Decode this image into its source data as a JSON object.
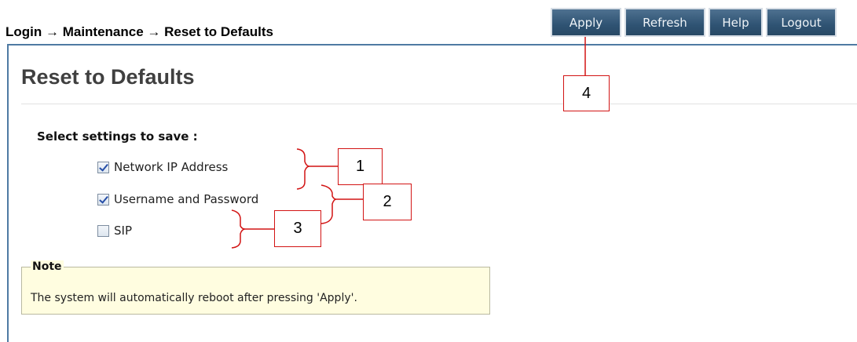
{
  "breadcrumb": "Login → Maintenance → Reset to Defaults",
  "toolbar": {
    "apply_label": "Apply",
    "refresh_label": "Refresh",
    "help_label": "Help",
    "logout_label": "Logout"
  },
  "page_title": "Reset to Defaults",
  "settings": {
    "label": "Select settings to save :",
    "options": [
      {
        "label": "Network IP Address",
        "checked": true
      },
      {
        "label": "Username and Password",
        "checked": true
      },
      {
        "label": "SIP",
        "checked": false
      }
    ]
  },
  "callouts": [
    "1",
    "2",
    "3",
    "4"
  ],
  "note": {
    "legend": "Note",
    "text": "The system will automatically reboot after pressing 'Apply'."
  },
  "colors": {
    "toolbar": "#2f5373",
    "callout_border": "#d21414",
    "note_bg": "#fffde0",
    "panel_border": "#4f7aa3"
  }
}
